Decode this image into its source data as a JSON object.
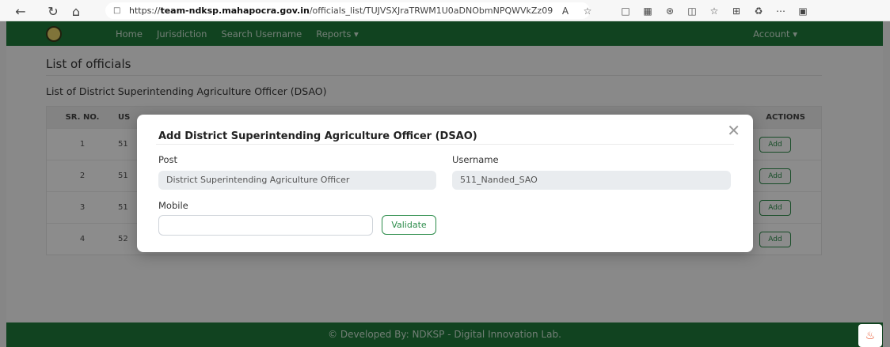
{
  "browser": {
    "url_prefix": "https://",
    "url_host": "team-ndksp.mahapocra.gov.in",
    "url_path": "/officials_list/TUJVSXJraTRWM1U0aDNObmNPQWVkZz09",
    "icons": [
      "back-icon",
      "refresh-icon",
      "home-icon",
      "lock-icon",
      "read-aloud-icon",
      "favorite-icon",
      "extension-icon",
      "split-screen-icon",
      "favorites-icon",
      "collections-icon",
      "more-icon",
      "sidebar-icon"
    ]
  },
  "navbar": {
    "items": [
      "Home",
      "Jurisdiction",
      "Search Username",
      "Reports ▾"
    ],
    "account": "Account ▾",
    "color": "#1f7a3b"
  },
  "page": {
    "title": "List of officials",
    "subtitle": "List of District Superintending Agriculture Officer (DSAO)"
  },
  "table": {
    "headers": {
      "sr": "SR. NO.",
      "username": "US",
      "actions": "ACTIONS"
    },
    "rows": [
      {
        "sr": "1",
        "username": "51"
      },
      {
        "sr": "2",
        "username": "51"
      },
      {
        "sr": "3",
        "username": "51"
      },
      {
        "sr": "4",
        "username": "52"
      }
    ],
    "action_label": "Add"
  },
  "modal": {
    "title": "Add District Superintending Agriculture Officer (DSAO)",
    "post_label": "Post",
    "post_value": "District Superintending Agriculture Officer",
    "username_label": "Username",
    "username_value": "511_Nanded_SAO",
    "mobile_label": "Mobile",
    "mobile_value": "",
    "validate_label": "Validate"
  },
  "footer": {
    "text": "© Developed By: NDKSP - Digital Innovation Lab."
  }
}
